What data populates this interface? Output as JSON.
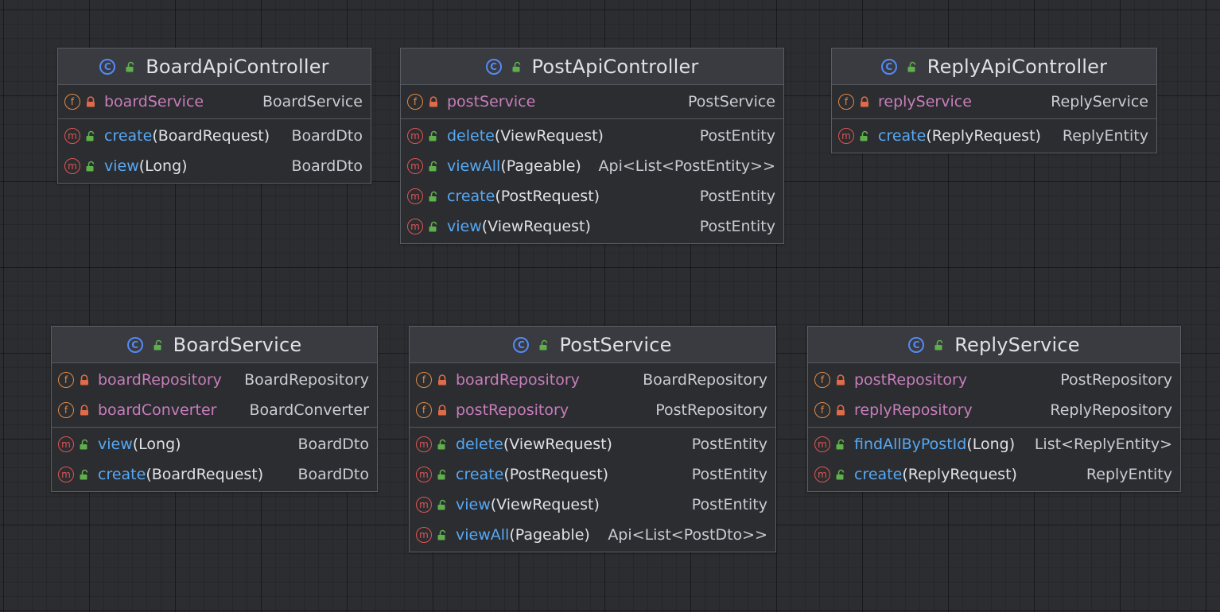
{
  "colors": {
    "background": "#2b2d30",
    "header": "#393b40",
    "class_icon": "#548af7",
    "field_icon": "#e08a4a",
    "method_icon": "#e05555",
    "field_name": "#c77dbb",
    "method_name": "#56a8f5",
    "public_lock": "#5fb04c",
    "private_lock": "#e06a4a"
  },
  "classes": {
    "board_api_controller": {
      "title": "BoardApiController",
      "fields": [
        {
          "name": "boardService",
          "type": "BoardService"
        }
      ],
      "methods": [
        {
          "name": "create",
          "params": "(BoardRequest)",
          "type": "BoardDto"
        },
        {
          "name": "view",
          "params": "(Long)",
          "type": "BoardDto"
        }
      ]
    },
    "post_api_controller": {
      "title": "PostApiController",
      "fields": [
        {
          "name": "postService",
          "type": "PostService"
        }
      ],
      "methods": [
        {
          "name": "delete",
          "params": "(ViewRequest)",
          "type": "PostEntity"
        },
        {
          "name": "viewAll",
          "params": "(Pageable)",
          "type": "Api<List<PostEntity>>"
        },
        {
          "name": "create",
          "params": "(PostRequest)",
          "type": "PostEntity"
        },
        {
          "name": "view",
          "params": "(ViewRequest)",
          "type": "PostEntity"
        }
      ]
    },
    "reply_api_controller": {
      "title": "ReplyApiController",
      "fields": [
        {
          "name": "replyService",
          "type": "ReplyService"
        }
      ],
      "methods": [
        {
          "name": "create",
          "params": "(ReplyRequest)",
          "type": "ReplyEntity"
        }
      ]
    },
    "board_service": {
      "title": "BoardService",
      "fields": [
        {
          "name": "boardRepository",
          "type": "BoardRepository"
        },
        {
          "name": "boardConverter",
          "type": "BoardConverter"
        }
      ],
      "methods": [
        {
          "name": "view",
          "params": "(Long)",
          "type": "BoardDto"
        },
        {
          "name": "create",
          "params": "(BoardRequest)",
          "type": "BoardDto"
        }
      ]
    },
    "post_service": {
      "title": "PostService",
      "fields": [
        {
          "name": "boardRepository",
          "type": "BoardRepository"
        },
        {
          "name": "postRepository",
          "type": "PostRepository"
        }
      ],
      "methods": [
        {
          "name": "delete",
          "params": "(ViewRequest)",
          "type": "PostEntity"
        },
        {
          "name": "create",
          "params": "(PostRequest)",
          "type": "PostEntity"
        },
        {
          "name": "view",
          "params": "(ViewRequest)",
          "type": "PostEntity"
        },
        {
          "name": "viewAll",
          "params": "(Pageable)",
          "type": "Api<List<PostDto>>"
        }
      ]
    },
    "reply_service": {
      "title": "ReplyService",
      "fields": [
        {
          "name": "postRepository",
          "type": "PostRepository"
        },
        {
          "name": "replyRepository",
          "type": "ReplyRepository"
        }
      ],
      "methods": [
        {
          "name": "findAllByPostId",
          "params": "(Long)",
          "type": "List<ReplyEntity>"
        },
        {
          "name": "create",
          "params": "(ReplyRequest)",
          "type": "ReplyEntity"
        }
      ]
    }
  }
}
